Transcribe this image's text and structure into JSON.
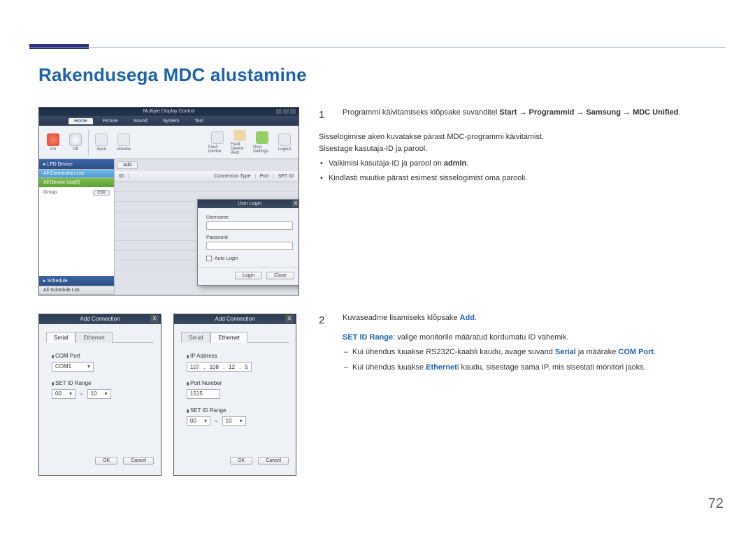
{
  "page": {
    "title": "Rakendusega MDC alustamine",
    "number": "72"
  },
  "fig1": {
    "app_title": "Multiple Display Control",
    "menutabs": [
      "Home",
      "Picture",
      "Sound",
      "System",
      "Tool"
    ],
    "toolbar": {
      "on": "On",
      "off": "Off",
      "input": "Input",
      "volume": "Volume",
      "fault_device": "Fault Device",
      "fault_alert": "Fault Device Alert",
      "user_settings": "User Settings",
      "logout": "Logout"
    },
    "side": {
      "lfd_header": "▸ LFD Device",
      "conn_list": "All Connection List",
      "device_list": "All Device List(0)",
      "group": "Group",
      "edit": "Edit",
      "schedule_header": "▸ Schedule",
      "schedule_list": "All Schedule List"
    },
    "cols": {
      "add": "Add",
      "id": "ID",
      "type": "Connection Type",
      "port": "Port",
      "setid": "SET ID"
    },
    "login": {
      "title": "User Login",
      "username": "Username",
      "password": "Password",
      "auto": "Auto Login",
      "login_btn": "Login",
      "close_btn": "Close"
    }
  },
  "fig_add": {
    "title": "Add Connection",
    "tabs": {
      "serial": "Serial",
      "ethernet": "Ethernet"
    },
    "serial": {
      "com_label": "COM Port",
      "com_value": "COM1",
      "range_label": "SET ID Range",
      "from": "00",
      "to": "10"
    },
    "ethernet": {
      "ip_label": "IP Address",
      "ip": [
        "107",
        "108",
        "12",
        "5"
      ],
      "port_label": "Port Number",
      "port_value": "1515",
      "range_label": "SET ID Range",
      "from": "00",
      "to": "10"
    },
    "ok": "OK",
    "cancel": "Cancel"
  },
  "step1": {
    "num": "1",
    "line1_a": "Programmi käivitamiseks klõpsake suvanditel ",
    "path": "Start → Programmid → Samsung → MDC Unified",
    "line2": "Sisselogimise aken kuvatakse pärast MDC-programmi käivitamist.",
    "line3": "Sisestage kasutaja-ID ja parool.",
    "b1_a": "Vaikimisi kasutaja-ID ja parool on ",
    "b1_b": "admin",
    "b2": "Kindlasti muutke pärast esimest sisselogimist oma parooli."
  },
  "step2": {
    "num": "2",
    "line1_a": "Kuvaseadme lisamiseks klõpsake ",
    "line1_b": "Add",
    "line2_a": "SET ID Range",
    "line2_b": ": valige monitorile määratud kordumatu ID vahemik.",
    "d1_a": "Kui ühendus luuakse RS232C-kaabli kaudu, avage suvand ",
    "d1_b": "Serial",
    "d1_c": " ja määrake ",
    "d1_d": "COM Port",
    "d2_a": "Kui ühendus luuakse ",
    "d2_b": "Ethernet",
    "d2_c": "i kaudu, sisestage sama IP, mis sisestati monitori jaoks."
  }
}
